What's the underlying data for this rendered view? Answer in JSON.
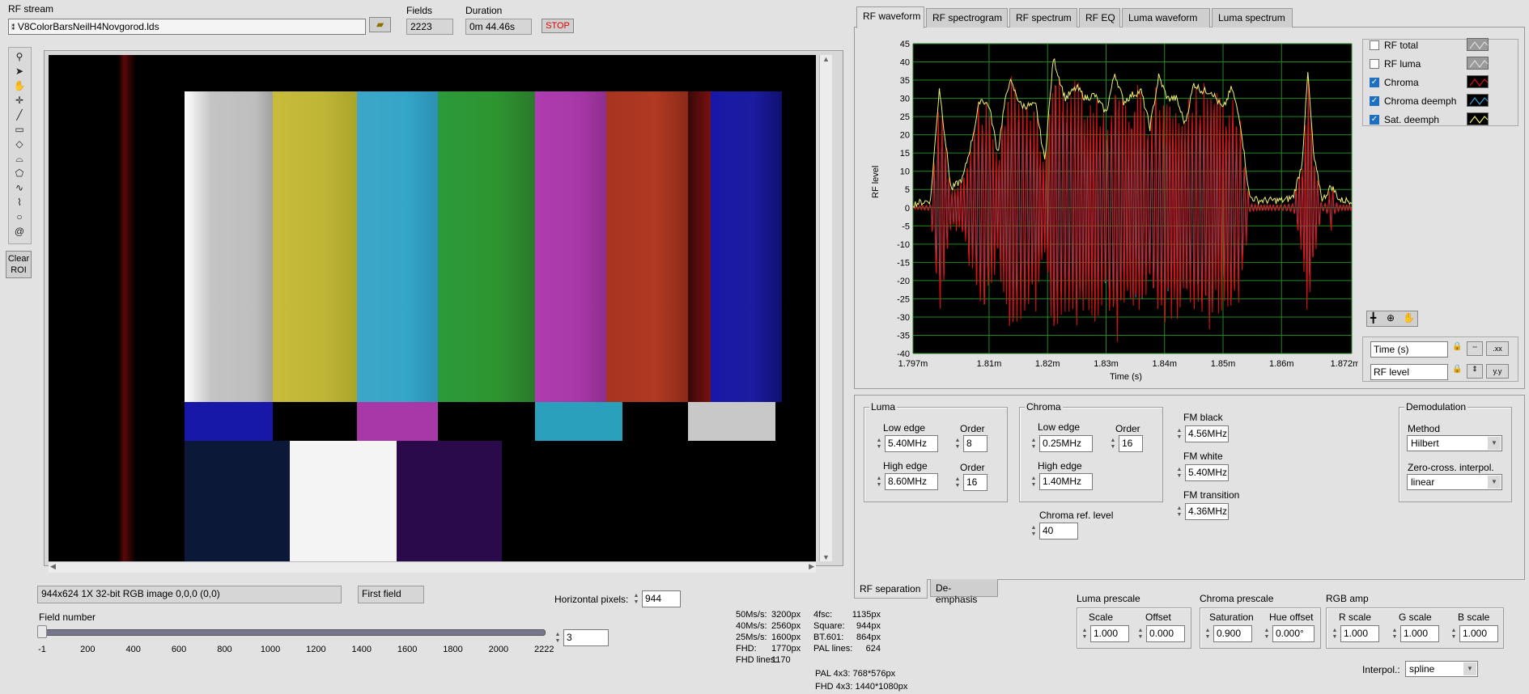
{
  "rf_stream": {
    "label": "RF stream",
    "value": "V8ColorBarsNeilH4Novgorod.lds"
  },
  "fields": {
    "label": "Fields",
    "value": "2223"
  },
  "duration": {
    "label": "Duration",
    "value": "0m 44.46s"
  },
  "stop_button": "STOP",
  "tools": [
    "zoom-icon",
    "pointer-icon",
    "pan-icon",
    "crosshair-icon",
    "line-icon",
    "rect-icon",
    "rotated-rect-icon",
    "annulus-icon",
    "polygon-icon",
    "freehand-icon",
    "broken-line-icon",
    "circle-icon",
    "spiral-icon"
  ],
  "clear_roi": {
    "line1": "Clear",
    "line2": "ROI"
  },
  "image_info": "944x624 1X 32-bit RGB image 0,0,0     (0,0)",
  "first_field": "First field",
  "horizontal_pixels": {
    "label": "Horizontal pixels:",
    "value": "944"
  },
  "field_number": {
    "label": "Field number",
    "value": "3",
    "ticks": [
      "-1",
      "200",
      "400",
      "600",
      "800",
      "1000",
      "1200",
      "1400",
      "1600",
      "1800",
      "2000",
      "2222"
    ]
  },
  "stats_left": [
    {
      "k": "50Ms/s:",
      "v": "3200px"
    },
    {
      "k": "40Ms/s:",
      "v": "2560px"
    },
    {
      "k": "25Ms/s:",
      "v": "1600px"
    },
    {
      "k": "FHD:",
      "v": "1770px"
    },
    {
      "k": "FHD lines:",
      "v": "1170"
    }
  ],
  "stats_right": [
    {
      "k": "4fsc:",
      "v": "1135px"
    },
    {
      "k": "Square:",
      "v": "944px"
    },
    {
      "k": "BT.601:",
      "v": "864px"
    },
    {
      "k": "PAL lines:",
      "v": "624"
    }
  ],
  "stats_bottom": [
    "PAL 4x3: 768*576px",
    "FHD 4x3: 1440*1080px"
  ],
  "tabs": [
    "RF waveform",
    "RF spectrogram",
    "RF spectrum",
    "RF EQ",
    "Luma waveform",
    "Luma spectrum"
  ],
  "chart_data": {
    "type": "line",
    "xlabel": "Time (s)",
    "ylabel": "RF level",
    "x_ticks": [
      "1.797m",
      "1.81m",
      "1.82m",
      "1.83m",
      "1.84m",
      "1.85m",
      "1.86m",
      "1.872m"
    ],
    "xlim": [
      0.001797,
      0.001872
    ],
    "ylim": [
      -40,
      45
    ],
    "y_ticks": [
      "45",
      "40",
      "35",
      "30",
      "25",
      "20",
      "15",
      "10",
      "5",
      "0",
      "-5",
      "-10",
      "-15",
      "-20",
      "-25",
      "-30",
      "-35",
      "-40"
    ],
    "grid": true,
    "background": "#000000",
    "grid_color": "#1f8a1f",
    "series": [
      {
        "name": "Chroma",
        "color": "#e01010"
      },
      {
        "name": "Chroma deemph",
        "color": "#30a0e0"
      },
      {
        "name": "Sat. deemph",
        "color": "#f0f070"
      }
    ],
    "envelope_x": [
      0.001797,
      0.0018,
      0.0018015,
      0.0018035,
      0.0018055,
      0.001807,
      0.0018085,
      0.00181,
      0.0018115,
      0.0018125,
      0.0018135,
      0.0018155,
      0.001818,
      0.0018195,
      0.001821,
      0.001823,
      0.001825,
      0.0018265,
      0.001828,
      0.00183,
      0.0018315,
      0.001833,
      0.0018345,
      0.001836,
      0.0018375,
      0.001839,
      0.0018405,
      0.001842,
      0.0018435,
      0.001845,
      0.0018465,
      0.001848,
      0.00185,
      0.0018515,
      0.001853,
      0.0018545,
      0.001856,
      0.0018575,
      0.001859,
      0.0018605,
      0.001862,
      0.0018635,
      0.0018645,
      0.0018655,
      0.001867,
      0.0018685,
      0.00187,
      0.001872
    ],
    "envelope_y": [
      1,
      2,
      33,
      5,
      8,
      18,
      30,
      28,
      15,
      27,
      35,
      28,
      28,
      13,
      41,
      30,
      33,
      30,
      31,
      26,
      37,
      29,
      31,
      32,
      22,
      36,
      30,
      30,
      23,
      34,
      32,
      32,
      27,
      33,
      23,
      3,
      2,
      2,
      2,
      2,
      3,
      12,
      37,
      14,
      2,
      6,
      2,
      2
    ]
  },
  "legend": [
    {
      "label": "RF total",
      "checked": false,
      "color": "#9a9a9a"
    },
    {
      "label": "RF luma",
      "checked": false,
      "color": "#9a9a9a"
    },
    {
      "label": "Chroma",
      "checked": true,
      "color": "#e01010"
    },
    {
      "label": "Chroma deemph",
      "checked": true,
      "color": "#30a0e0"
    },
    {
      "label": "Sat. deemph",
      "checked": true,
      "color": "#f0f070"
    }
  ],
  "scale_legend": [
    {
      "label": "Time (s)",
      "fmt": ".xx"
    },
    {
      "label": "RF level",
      "fmt": "y.y"
    }
  ],
  "luma": {
    "title": "Luma",
    "low_edge_label": "Low edge",
    "low_edge": "5.40MHz",
    "order1_label": "Order",
    "order1": "8",
    "high_edge_label": "High edge",
    "high_edge": "8.60MHz",
    "order2_label": "Order",
    "order2": "16"
  },
  "chroma": {
    "title": "Chroma",
    "low_edge_label": "Low edge",
    "low_edge": "0.25MHz",
    "order_label": "Order",
    "order": "16",
    "high_edge_label": "High edge",
    "high_edge": "1.40MHz",
    "ref_label": "Chroma ref. level",
    "ref": "40"
  },
  "fm": {
    "black_label": "FM black",
    "black": "4.56MHz",
    "white_label": "FM white",
    "white": "5.40MHz",
    "transition_label": "FM transition",
    "transition": "4.36MHz"
  },
  "demod": {
    "title": "Demodulation",
    "method_label": "Method",
    "method": "Hilbert",
    "zc_label": "Zero-cross. interpol.",
    "zc": "linear"
  },
  "bottom_tabs": [
    "RF separation",
    "De-emphasis"
  ],
  "luma_prescale": {
    "title": "Luma prescale",
    "scale_label": "Scale",
    "scale": "1.000",
    "offset_label": "Offset",
    "offset": "0.000"
  },
  "chroma_prescale": {
    "title": "Chroma prescale",
    "sat_label": "Saturation",
    "sat": "0.900",
    "hue_label": "Hue offset",
    "hue": "0.000°"
  },
  "rgb_amp": {
    "title": "RGB amp",
    "r_label": "R scale",
    "r": "1.000",
    "g_label": "G scale",
    "g": "1.000",
    "b_label": "B scale",
    "b": "1.000"
  },
  "interpol": {
    "label": "Interpol.:",
    "value": "spline"
  }
}
